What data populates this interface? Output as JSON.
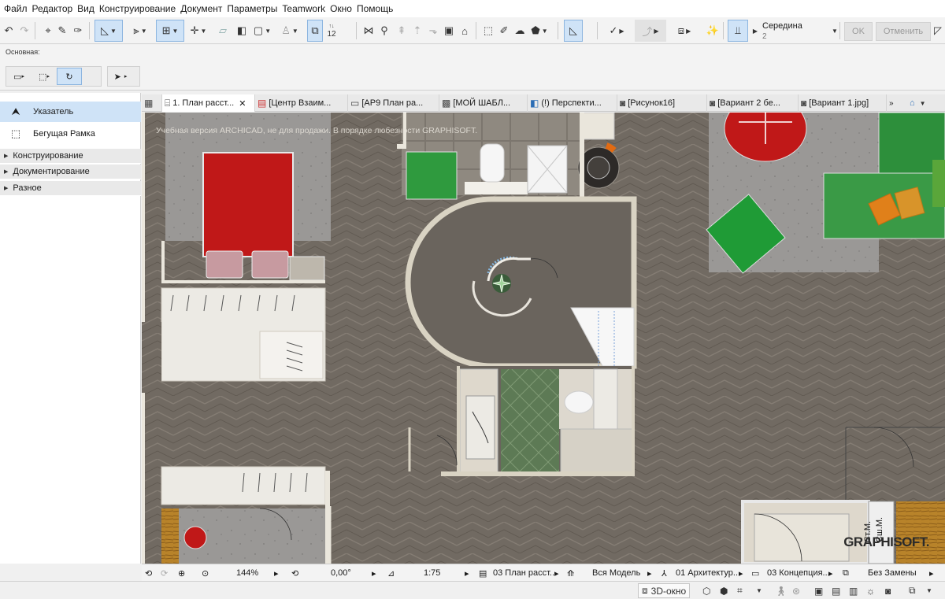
{
  "menu": [
    "Файл",
    "Редактор",
    "Вид",
    "Конструирование",
    "Документ",
    "Параметры",
    "Teamwork",
    "Окно",
    "Помощь"
  ],
  "toolbar": {
    "snap_title": "Середина",
    "snap_value": "2",
    "ok_label": "OK",
    "cancel_label": "Отменить",
    "layer_num": "12"
  },
  "toolbar2": {
    "label": "Основная:"
  },
  "left_panel": {
    "items": [
      {
        "label": "Указатель",
        "icon": "pointer-arrow-icon",
        "selected": true
      },
      {
        "label": "Бегущая Рамка",
        "icon": "marquee-icon",
        "selected": false
      }
    ],
    "sections": [
      "Конструирование",
      "Документирование",
      "Разное"
    ]
  },
  "tabs": [
    {
      "label": "1. План расст...",
      "icon": "floor-plan-icon",
      "active": true,
      "closable": true
    },
    {
      "label": "[Центр Взаим...",
      "icon": "document-icon",
      "active": false
    },
    {
      "label": "[АР9 План ра...",
      "icon": "layout-icon",
      "active": false
    },
    {
      "label": "[МОЙ ШАБЛ...",
      "icon": "layout-icon",
      "active": false
    },
    {
      "label": "(!) Перспекти...",
      "icon": "perspective-icon",
      "active": false
    },
    {
      "label": "[Рисунок16]",
      "icon": "camera-icon",
      "active": false
    },
    {
      "label": "[Вариант 2 бе...",
      "icon": "camera-icon",
      "active": false
    },
    {
      "label": "[Вариант 1.jpg]",
      "icon": "camera-icon",
      "active": false
    }
  ],
  "canvas": {
    "watermark": "Учебная версия ARCHICAD, не для продажи. В порядке любезности GRAPHISOFT.",
    "logo": "GRAPHISOFT.",
    "room_labels": [
      "Ст.М.",
      "Сш.М."
    ]
  },
  "statusbar": {
    "zoom": "144%",
    "angle": "0,00°",
    "scale": "1:75",
    "view": "03 План расст...",
    "model": "Вся Модель",
    "layer_combo": "01 Архитектур...",
    "concept": "03 Концепция...",
    "override": "Без Замены"
  },
  "bottombar": {
    "window3d_label": "3D-окно"
  },
  "colors": {
    "accent_blue": "#cfe3f7",
    "floor": "#716a62",
    "bed_red": "#c01818",
    "green": "#2f9a3e"
  }
}
